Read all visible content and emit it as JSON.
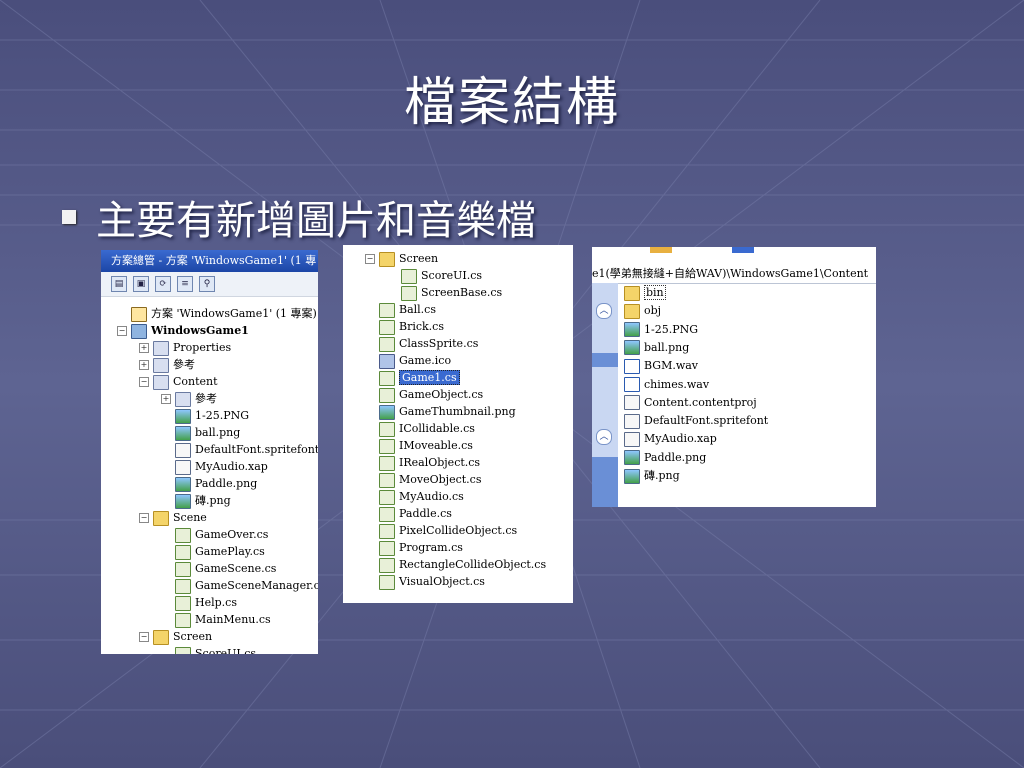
{
  "slide": {
    "title": "檔案結構",
    "bullet": "主要有新增圖片和音樂檔"
  },
  "solution_explorer": {
    "title": "方案總管 - 方案 'WindowsGame1' (1 專",
    "items": [
      {
        "label": "方案 'WindowsGame1' (1 專案)",
        "icon": "solution-icon",
        "level": 0,
        "expander": ""
      },
      {
        "label": "WindowsGame1",
        "icon": "project-icon",
        "level": 0,
        "expander": "-",
        "bold": true
      },
      {
        "label": "Properties",
        "icon": "properties-icon",
        "level": 1,
        "expander": "+"
      },
      {
        "label": "參考",
        "icon": "references-icon",
        "level": 1,
        "expander": "+"
      },
      {
        "label": "Content",
        "icon": "content-icon",
        "level": 1,
        "expander": "-"
      },
      {
        "label": "參考",
        "icon": "references-icon",
        "level": 2,
        "expander": "+"
      },
      {
        "label": "1-25.PNG",
        "icon": "image-icon",
        "level": 2,
        "expander": ""
      },
      {
        "label": "ball.png",
        "icon": "image-icon",
        "level": 2,
        "expander": ""
      },
      {
        "label": "DefaultFont.spritefont",
        "icon": "file-icon",
        "level": 2,
        "expander": ""
      },
      {
        "label": "MyAudio.xap",
        "icon": "file-icon",
        "level": 2,
        "expander": ""
      },
      {
        "label": "Paddle.png",
        "icon": "image-icon",
        "level": 2,
        "expander": ""
      },
      {
        "label": "磚.png",
        "icon": "image-icon",
        "level": 2,
        "expander": ""
      },
      {
        "label": "Scene",
        "icon": "folder-icon",
        "level": 1,
        "expander": "-"
      },
      {
        "label": "GameOver.cs",
        "icon": "cs-file-icon",
        "level": 2,
        "expander": ""
      },
      {
        "label": "GamePlay.cs",
        "icon": "cs-file-icon",
        "level": 2,
        "expander": ""
      },
      {
        "label": "GameScene.cs",
        "icon": "cs-file-icon",
        "level": 2,
        "expander": ""
      },
      {
        "label": "GameSceneManager.cs",
        "icon": "cs-file-icon",
        "level": 2,
        "expander": ""
      },
      {
        "label": "Help.cs",
        "icon": "cs-file-icon",
        "level": 2,
        "expander": ""
      },
      {
        "label": "MainMenu.cs",
        "icon": "cs-file-icon",
        "level": 2,
        "expander": ""
      },
      {
        "label": "Screen",
        "icon": "folder-icon",
        "level": 1,
        "expander": "-"
      },
      {
        "label": "ScoreUI.cs",
        "icon": "cs-file-icon",
        "level": 2,
        "expander": ""
      }
    ]
  },
  "file_list": {
    "items": [
      {
        "label": "Screen",
        "icon": "folder-icon",
        "level": 0,
        "expander": "-"
      },
      {
        "label": "ScoreUI.cs",
        "icon": "cs-file-icon",
        "level": 1,
        "expander": ""
      },
      {
        "label": "ScreenBase.cs",
        "icon": "cs-file-icon",
        "level": 1,
        "expander": ""
      },
      {
        "label": "Ball.cs",
        "icon": "cs-file-icon",
        "level": 0,
        "expander": ""
      },
      {
        "label": "Brick.cs",
        "icon": "cs-file-icon",
        "level": 0,
        "expander": ""
      },
      {
        "label": "ClassSprite.cs",
        "icon": "cs-file-icon",
        "level": 0,
        "expander": ""
      },
      {
        "label": "Game.ico",
        "icon": "ico-file-icon",
        "level": 0,
        "expander": ""
      },
      {
        "label": "Game1.cs",
        "icon": "cs-file-icon",
        "level": 0,
        "expander": "",
        "selected": true
      },
      {
        "label": "GameObject.cs",
        "icon": "cs-file-icon",
        "level": 0,
        "expander": ""
      },
      {
        "label": "GameThumbnail.png",
        "icon": "image-icon",
        "level": 0,
        "expander": ""
      },
      {
        "label": "ICollidable.cs",
        "icon": "cs-file-icon",
        "level": 0,
        "expander": ""
      },
      {
        "label": "IMoveable.cs",
        "icon": "cs-file-icon",
        "level": 0,
        "expander": ""
      },
      {
        "label": "IRealObject.cs",
        "icon": "cs-file-icon",
        "level": 0,
        "expander": ""
      },
      {
        "label": "MoveObject.cs",
        "icon": "cs-file-icon",
        "level": 0,
        "expander": ""
      },
      {
        "label": "MyAudio.cs",
        "icon": "cs-file-icon",
        "level": 0,
        "expander": ""
      },
      {
        "label": "Paddle.cs",
        "icon": "cs-file-icon",
        "level": 0,
        "expander": ""
      },
      {
        "label": "PixelCollideObject.cs",
        "icon": "cs-file-icon",
        "level": 0,
        "expander": ""
      },
      {
        "label": "Program.cs",
        "icon": "cs-file-icon",
        "level": 0,
        "expander": ""
      },
      {
        "label": "RectangleCollideObject.cs",
        "icon": "cs-file-icon",
        "level": 0,
        "expander": ""
      },
      {
        "label": "VisualObject.cs",
        "icon": "cs-file-icon",
        "level": 0,
        "expander": ""
      }
    ]
  },
  "explorer": {
    "address": "e1(學弟無接縫+自給WAV)\\WindowsGame1\\Content",
    "items": [
      {
        "label": "bin",
        "icon": "folder-icon",
        "selected": true
      },
      {
        "label": "obj",
        "icon": "folder-icon"
      },
      {
        "label": "1-25.PNG",
        "icon": "image-icon"
      },
      {
        "label": "ball.png",
        "icon": "image-icon"
      },
      {
        "label": "BGM.wav",
        "icon": "audio-icon"
      },
      {
        "label": "chimes.wav",
        "icon": "audio-icon"
      },
      {
        "label": "Content.contentproj",
        "icon": "file-icon"
      },
      {
        "label": "DefaultFont.spritefont",
        "icon": "file-icon"
      },
      {
        "label": "MyAudio.xap",
        "icon": "file-icon"
      },
      {
        "label": "Paddle.png",
        "icon": "image-icon"
      },
      {
        "label": "磚.png",
        "icon": "image-icon"
      }
    ]
  },
  "colors": {
    "background": "#555a86",
    "title_bar": "#2a55b8",
    "selection": "#3a6ad0"
  }
}
